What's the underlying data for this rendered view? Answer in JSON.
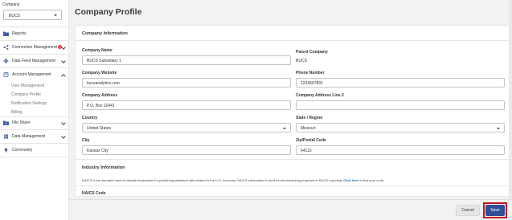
{
  "sidebar": {
    "company_label": "Company",
    "company_selected": "BUCS",
    "items": [
      {
        "label": "Reports",
        "icon": "folder-icon"
      },
      {
        "label": "Connection Management",
        "icon": "share-icon",
        "badge": "!"
      },
      {
        "label": "Data Feed Management",
        "icon": "gear-icon"
      },
      {
        "label": "Account Management",
        "icon": "book-icon"
      },
      {
        "label": "File Share",
        "icon": "file-share-icon"
      },
      {
        "label": "Data Management",
        "icon": "data-icon"
      },
      {
        "label": "Community",
        "icon": "lightbulb-icon"
      }
    ],
    "account_sub": [
      "User Management",
      "Company Profile",
      "Notification Settings",
      "Billing"
    ]
  },
  "page": {
    "title": "Company Profile"
  },
  "company_info": {
    "section_title": "Company Information",
    "name_label": "Company Name",
    "name_value": "BUCS Subsidiary 1",
    "parent_label": "Parent Company",
    "parent_value": "BUCS",
    "website_label": "Company Website",
    "website_value": "bucsanalytics.com",
    "phone_label": "Phone Number",
    "phone_value": "1234567891",
    "address_label": "Company Address",
    "address_value": "P.O. Box 22441",
    "address2_label": "Company Address Line 2",
    "address2_value": "",
    "country_label": "Country",
    "country_value": "United States",
    "state_label": "State / Region",
    "state_value": "Missouri",
    "city_label": "City",
    "city_value": "Kansas City",
    "zip_label": "Zip/Postal Code",
    "zip_value": "64113"
  },
  "industry_info": {
    "section_title": "Industry Information",
    "note": "NAICS is the standard used to classify businesses for publishing statistical data related to the U.S. economy. NAICS information is used for benchmarking purposes in BUCS reporting.",
    "note_link": "Click here",
    "note_tail": "to find your code.",
    "naics_label": "NAICS Code"
  },
  "footer": {
    "cancel_label": "Cancel",
    "save_label": "Save"
  },
  "colors": {
    "save": "#2f4f98",
    "highlight": "#c0141b",
    "badge": "#e23b3b",
    "icon": "#3f5fa6"
  }
}
